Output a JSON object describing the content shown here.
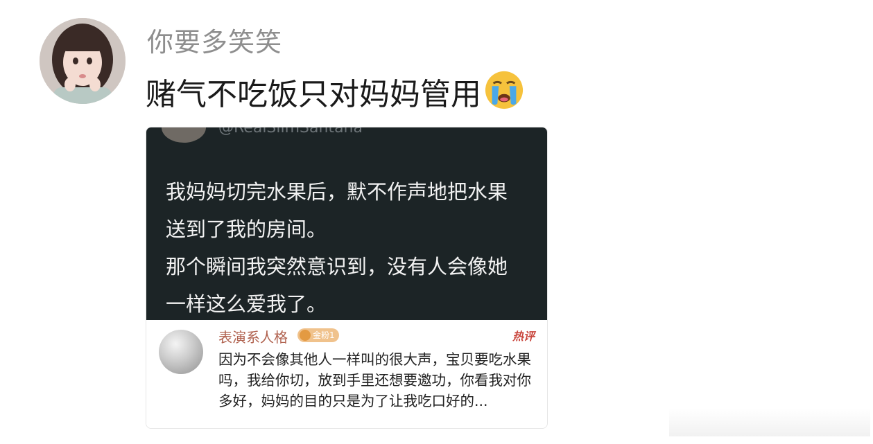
{
  "post": {
    "username": "你要多笑笑",
    "text": "赌气不吃饭只对妈妈管用",
    "emoji": "crying-face-icon"
  },
  "embedded": {
    "tweet": {
      "handle": "@RealSlimSantana",
      "lines": [
        "我妈妈切完水果后，默不作声地把水果",
        "送到了我的房间。",
        "那个瞬间我突然意识到，没有人会像她",
        "一样这么爱我了。"
      ]
    },
    "comment": {
      "name": "表演系人格",
      "badge": "金粉1",
      "hot": "热评",
      "text": "因为不会像其他人一样叫的很大声，宝贝要吃水果吗，我给你切，放到手里还想要邀功，你看我对你多好，妈妈的目的只是为了让我吃口好的..."
    }
  },
  "colors": {
    "username": "#8e8e8e",
    "dark_panel": "#1c2426",
    "comment_name": "#b0614e",
    "hot_tag": "#c9463d"
  }
}
